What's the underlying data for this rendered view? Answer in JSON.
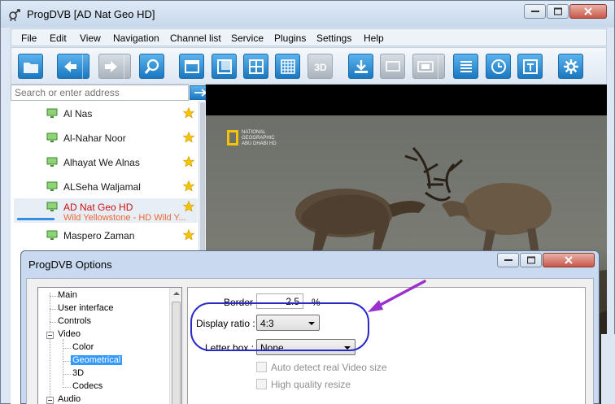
{
  "window": {
    "title": "ProgDVB [AD Nat Geo HD]"
  },
  "menu": [
    "File",
    "Edit",
    "View",
    "Navigation",
    "Channel list",
    "Service",
    "Plugins",
    "Settings",
    "Help"
  ],
  "toolbar": {
    "three_d_label": "3D"
  },
  "search": {
    "placeholder": "Search or enter address"
  },
  "channels": [
    {
      "name": "Al Nas"
    },
    {
      "name": "Al-Nahar Noor"
    },
    {
      "name": "Alhayat We Alnas"
    },
    {
      "name": "ALSeha Waljamal"
    },
    {
      "name": "AD Nat Geo HD",
      "program": "Wild Yellowstone - HD  Wild Y...",
      "selected": true
    },
    {
      "name": "Maspero Zaman"
    }
  ],
  "video": {
    "logo_text": [
      "NATIONAL",
      "GEOGRAPHIC",
      "ABU DHABI HD"
    ]
  },
  "dialog": {
    "title": "ProgDVB Options",
    "tree": [
      "Main",
      "User interface",
      "Controls",
      "Video",
      "Color",
      "Geometrical",
      "3D",
      "Codecs",
      "Audio"
    ],
    "selected_tree_item": "Geometrical",
    "border_label": "Border :",
    "border_value": "2.5",
    "border_unit": "%",
    "display_ratio_label": "Display ratio :",
    "display_ratio_value": "4:3",
    "letter_box_label": "Letter box :",
    "letter_box_value": "None",
    "auto_detect_label": "Auto detect real Video size",
    "high_quality_label": "High quality resize"
  },
  "colors": {
    "accent_blue": "#1a78c0",
    "selected_channel_text": "#cc1010",
    "program_text": "#ee6633",
    "annotation_ellipse": "#2a2ac8",
    "annotation_arrow": "#9b30d0",
    "favorite_star": "#f5c400"
  }
}
